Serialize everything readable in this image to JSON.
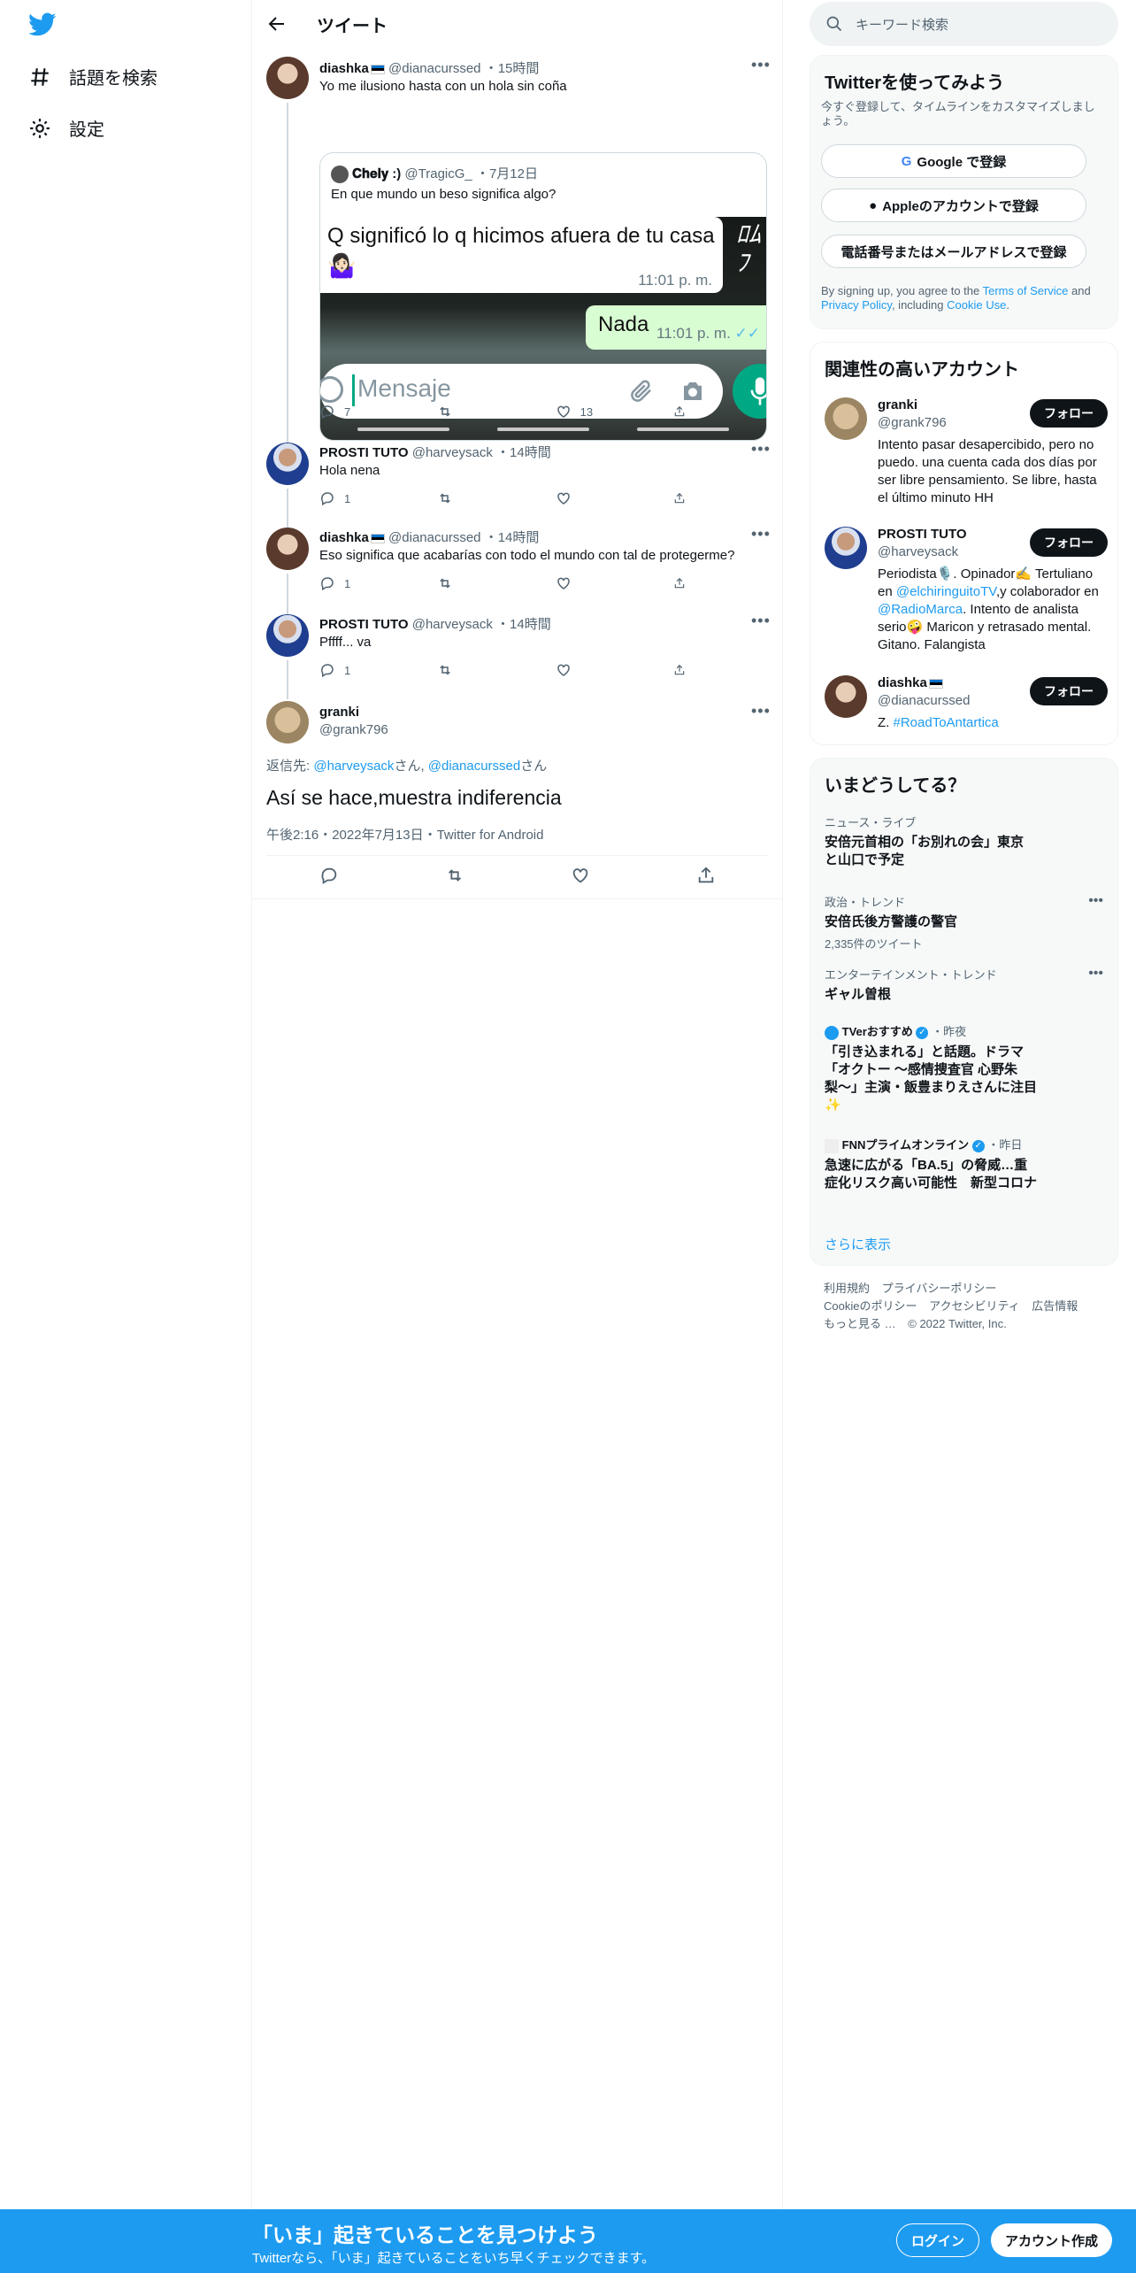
{
  "nav": {
    "explore_label": "話題を検索",
    "settings_label": "設定"
  },
  "header": {
    "title": "ツイート"
  },
  "thread": [
    {
      "name": "diashka",
      "handle": "@dianacurssed",
      "time": "15時間",
      "text": "Yo me ilusiono hasta con un hola sin coña",
      "quote": {
        "name": "𝐂𝐡𝐞𝐥𝐲 :)",
        "handle": "@TragicG_",
        "time": "7月12日",
        "text": "En que mundo un beso significa algo?",
        "image": {
          "msg1": "Q significó lo q hicimos afuera de tu casa",
          "msg1_emoji": "🤷🏻‍♀️",
          "msg1_time": "11:01 p. m.",
          "msg2": "Nada",
          "msg2_time": "11:01 p. m.",
          "input_placeholder": "Mensaje"
        }
      },
      "replies": "7",
      "retweets": "",
      "likes": "13"
    },
    {
      "name": "PROSTI TUTO",
      "handle": "@harveysack",
      "time": "14時間",
      "text": "Hola nena",
      "replies": "1",
      "retweets": "",
      "likes": ""
    },
    {
      "name": "diashka",
      "handle": "@dianacurssed",
      "time": "14時間",
      "text": "Eso significa que acabarías con todo el mundo con tal de protegerme?",
      "replies": "1",
      "retweets": "",
      "likes": ""
    },
    {
      "name": "PROSTI TUTO",
      "handle": "@harveysack",
      "time": "14時間",
      "text": "Pffff... va",
      "replies": "1",
      "retweets": "",
      "likes": ""
    }
  ],
  "focused": {
    "name": "granki",
    "handle": "@grank796",
    "reply_prefix": "返信先: ",
    "reply_user1": "@harveysack",
    "reply_san1": "さん, ",
    "reply_user2": "@dianacurssed",
    "reply_san2": "さん",
    "text": "Así se hace,muestra indiferencia",
    "timestamp": "午後2:16・2022年7月13日・Twitter for Android"
  },
  "search": {
    "placeholder": "キーワード検索"
  },
  "signup_card": {
    "title": "Twitterを使ってみよう",
    "subtitle": "今すぐ登録して、タイムラインをカスタマイズしましょう。",
    "google": "Google で登録",
    "apple": "Appleのアカウントで登録",
    "phone": "電話番号またはメールアドレスで登録",
    "tos_1": "By signing up, you agree to the ",
    "tos_link1": "Terms of Service",
    "tos_2": " and ",
    "tos_link2": "Privacy Policy",
    "tos_3": ", including ",
    "tos_link3": "Cookie Use",
    "tos_4": "."
  },
  "related": {
    "title": "関連性の高いアカウント",
    "follow_label": "フォロー",
    "accounts": [
      {
        "name": "granki",
        "handle": "@grank796",
        "bio": "Intento pasar desapercibido, pero no puedo. una cuenta cada dos días por ser libre pensamiento. Se libre, hasta el último minuto HH"
      },
      {
        "name": "PROSTI TUTO",
        "handle": "@harveysack",
        "bio_1": "Periodista🎙️. Opinador✍️ Tertuliano en ",
        "bio_link1": "@elchiringuitoTV",
        "bio_2": ",y colaborador en ",
        "bio_link2": "@RadioMarca",
        "bio_3": ". Intento de analista serio🤪 Maricon y retrasado mental. Gitano. Falangista"
      },
      {
        "name": "diashka",
        "handle": "@dianacurssed",
        "bio_1": "Z. ",
        "bio_link1": "#RoadToAntartica"
      }
    ]
  },
  "trends": {
    "title": "いまどうしてる？",
    "items": [
      {
        "context": "ニュース・ライブ",
        "title": "安倍元首相の「お別れの会」東京と山口で予定"
      },
      {
        "context": "政治・トレンド",
        "title": "安倍氏後方警護の警官",
        "count": "2,335件のツイート"
      },
      {
        "context": "エンターテインメント・トレンド",
        "title": "ギャル曽根"
      },
      {
        "source": "TVerおすすめ",
        "time": "・昨夜",
        "title": "「引き込まれる」と話題。ドラマ「オクトー 〜感情捜査官 心野朱梨〜」主演・飯豊まりえさんに注目✨"
      },
      {
        "source": "FNNプライムオンライン",
        "time": "・昨日",
        "title": "急速に広がる「BA.5」の脅威…重症化リスク高い可能性　新型コロナ"
      }
    ],
    "show_more": "さらに表示"
  },
  "footer": {
    "terms": "利用規約",
    "privacy": "プライバシーポリシー",
    "cookie": "Cookieのポリシー",
    "accessibility": "アクセシビリティ",
    "ads": "広告情報",
    "more": "もっと見る …",
    "copyright": "© 2022 Twitter, Inc."
  },
  "banner": {
    "title": "「いま」起きていることを見つけよう",
    "subtitle": "Twitterなら、「いま」起きていることをいち早くチェックできます。",
    "login": "ログイン",
    "signup": "アカウント作成"
  },
  "colors": {
    "accent": "#1d9bf0",
    "text": "#0f1419",
    "muted": "#536471",
    "whatsapp_green": "#00a884",
    "whatsapp_bubble_out": "#d9fdd3"
  }
}
